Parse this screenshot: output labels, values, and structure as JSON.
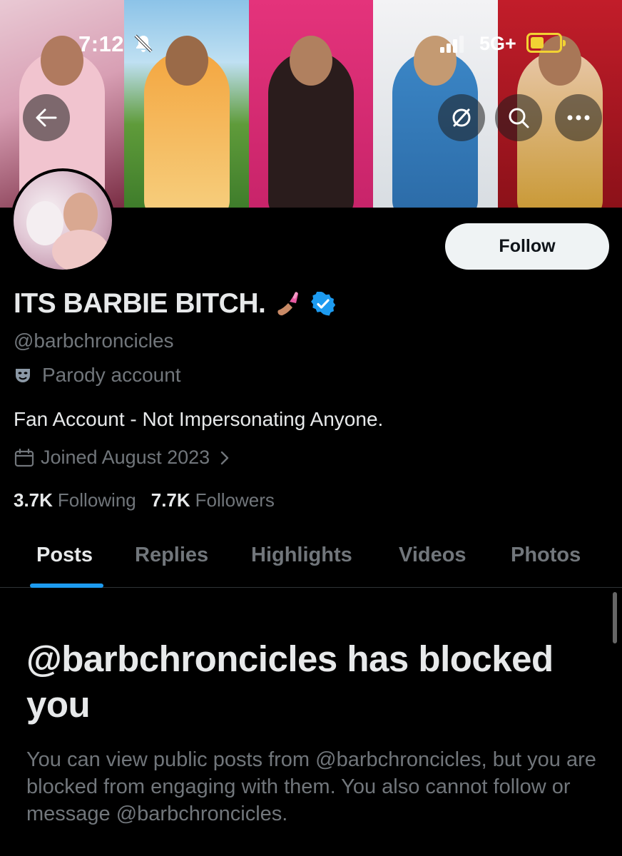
{
  "status_bar": {
    "time": "7:12",
    "network": "5G+"
  },
  "banner": {
    "photos": [
      "photo-1",
      "photo-2",
      "photo-3",
      "photo-4",
      "photo-5"
    ]
  },
  "header_buttons": [
    "back-arrow-icon",
    "sync-icon",
    "search-icon",
    "more-icon"
  ],
  "profile": {
    "display_name": "ITS BARBIE BITCH.",
    "handle": "@barbchroncicles",
    "label": "Parody account",
    "bio": "Fan Account - Not Impersonating Anyone.",
    "joined": "Joined August 2023",
    "following_count": "3.7K",
    "following_label": "Following",
    "followers_count": "7.7K",
    "followers_label": "Followers",
    "follow_button": "Follow"
  },
  "tabs": [
    {
      "label": "Posts",
      "active": true
    },
    {
      "label": "Replies"
    },
    {
      "label": "Highlights"
    },
    {
      "label": "Videos"
    },
    {
      "label": "Photos"
    }
  ],
  "blocked": {
    "title": "@barbchroncicles has blocked you",
    "message": "You can view public posts from @barbchroncicles, but you are blocked from engaging with them. You also cannot follow or message @barbchroncicles."
  },
  "colors": {
    "accent": "#1d9bf0",
    "background": "#000000",
    "muted": "#71767b",
    "text": "#e7e9ea",
    "battery": "#f2d233"
  }
}
